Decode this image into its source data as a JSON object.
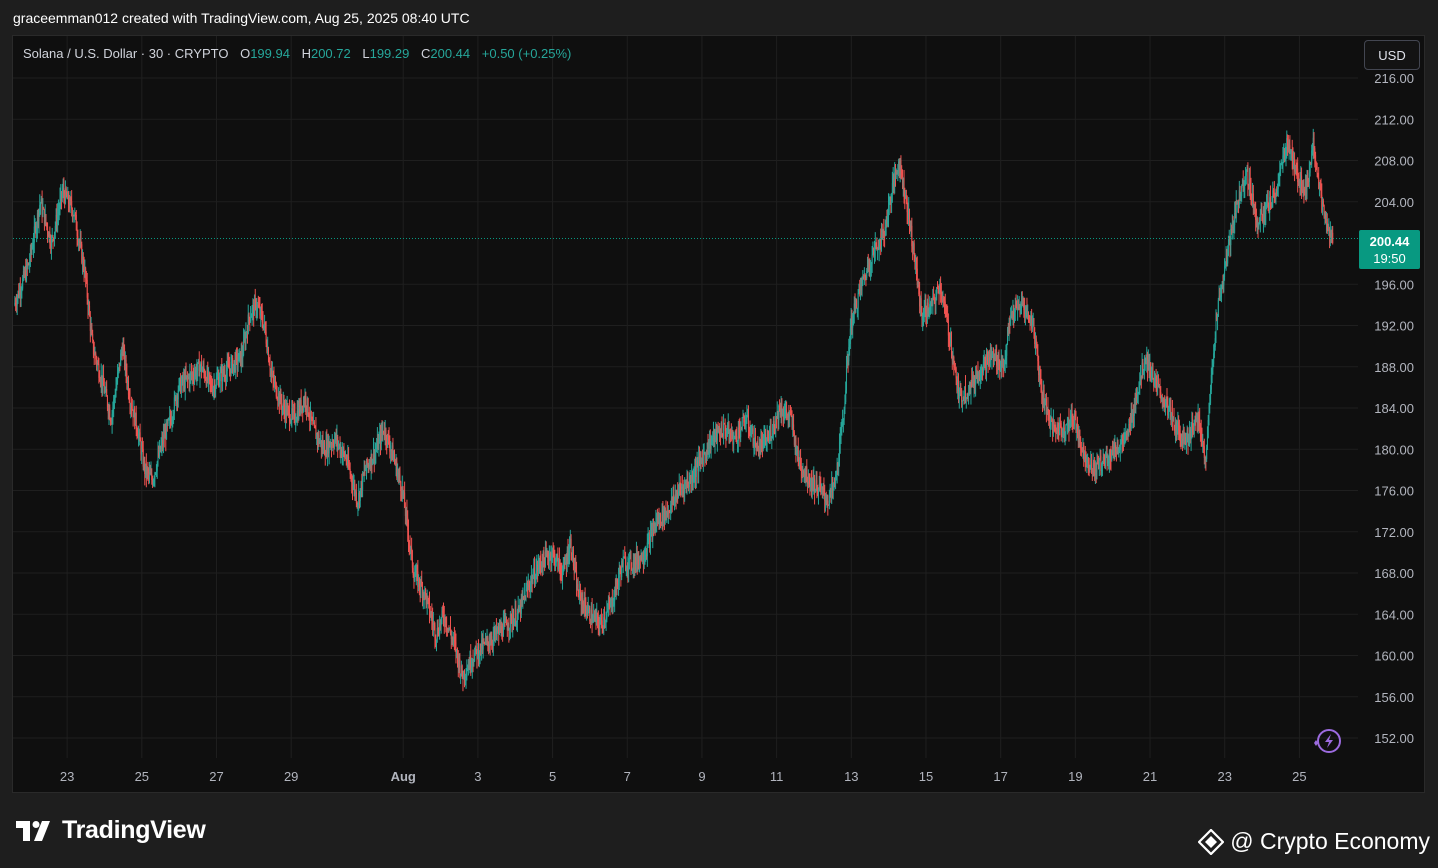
{
  "header": {
    "caption": "graceemman012 created with TradingView.com, Aug 25, 2025 08:40 UTC"
  },
  "legend": {
    "symbol": "Solana / U.S. Dollar · 30 · CRYPTO",
    "o_label": "O",
    "o_value": "199.94",
    "h_label": "H",
    "h_value": "200.72",
    "l_label": "L",
    "l_value": "199.29",
    "c_label": "C",
    "c_value": "200.44",
    "change": "+0.50 (+0.25%)"
  },
  "currency_button": "USD",
  "price_label": {
    "price": "200.44",
    "countdown": "19:50"
  },
  "colors": {
    "up": "#26a69a",
    "down": "#ef5350",
    "price_line": "#089981",
    "grid": "#1f1f1f",
    "background": "#0f0f0f",
    "accent_icon": "#9c6bdf"
  },
  "icons": {
    "logo": "tradingview-logo-icon",
    "credit": "crypto-economy-logo-icon",
    "flash": "lightning-icon"
  },
  "brand": {
    "name": "TradingView"
  },
  "credit": {
    "text": "@ Crypto Economy"
  },
  "chart_data": {
    "type": "candlestick",
    "title": "Solana / U.S. Dollar · 30 · CRYPTO",
    "timeframe": "30",
    "current_price": 200.44,
    "y_range": [
      150,
      217
    ],
    "y_ticks": [
      216,
      212,
      208,
      204,
      196,
      192,
      188,
      184,
      180,
      176,
      172,
      168,
      164,
      160,
      156,
      152
    ],
    "y_tick_labels": [
      "216.00",
      "212.00",
      "208.00",
      "204.00",
      "196.00",
      "192.00",
      "188.00",
      "184.00",
      "180.00",
      "176.00",
      "172.00",
      "168.00",
      "164.00",
      "160.00",
      "156.00",
      "152.00"
    ],
    "x_ticks": [
      {
        "label": "23",
        "day": 23
      },
      {
        "label": "25",
        "day": 25
      },
      {
        "label": "27",
        "day": 27
      },
      {
        "label": "29",
        "day": 29
      },
      {
        "label": "Aug",
        "day": 32,
        "bold": true
      },
      {
        "label": "3",
        "day": 34
      },
      {
        "label": "5",
        "day": 36
      },
      {
        "label": "7",
        "day": 38
      },
      {
        "label": "9",
        "day": 40
      },
      {
        "label": "11",
        "day": 42
      },
      {
        "label": "13",
        "day": 44
      },
      {
        "label": "15",
        "day": 46
      },
      {
        "label": "17",
        "day": 48
      },
      {
        "label": "19",
        "day": 50
      },
      {
        "label": "21",
        "day": 52
      },
      {
        "label": "23",
        "day": 54
      },
      {
        "label": "25",
        "day": 56
      }
    ],
    "x_day_range": [
      21.6,
      56.9
    ],
    "price_path": [
      [
        21.6,
        194
      ],
      [
        22.0,
        198
      ],
      [
        22.3,
        204
      ],
      [
        22.6,
        200
      ],
      [
        22.9,
        205
      ],
      [
        23.2,
        203
      ],
      [
        23.5,
        197
      ],
      [
        23.7,
        190
      ],
      [
        24.0,
        186
      ],
      [
        24.2,
        183
      ],
      [
        24.5,
        190
      ],
      [
        24.7,
        185
      ],
      [
        24.9,
        182
      ],
      [
        25.1,
        178
      ],
      [
        25.3,
        177
      ],
      [
        25.6,
        181
      ],
      [
        25.8,
        183
      ],
      [
        26.0,
        186
      ],
      [
        26.3,
        187
      ],
      [
        26.6,
        188
      ],
      [
        26.9,
        186
      ],
      [
        27.1,
        187
      ],
      [
        27.4,
        188
      ],
      [
        27.7,
        189
      ],
      [
        27.9,
        193
      ],
      [
        28.1,
        194
      ],
      [
        28.3,
        192
      ],
      [
        28.5,
        187
      ],
      [
        28.8,
        184
      ],
      [
        29.1,
        183
      ],
      [
        29.4,
        185
      ],
      [
        29.6,
        182
      ],
      [
        29.9,
        180
      ],
      [
        30.2,
        181
      ],
      [
        30.5,
        179
      ],
      [
        30.8,
        175
      ],
      [
        31.0,
        178
      ],
      [
        31.3,
        180
      ],
      [
        31.5,
        182
      ],
      [
        31.7,
        180
      ],
      [
        32.0,
        176
      ],
      [
        32.3,
        168
      ],
      [
        32.6,
        166
      ],
      [
        32.9,
        162
      ],
      [
        33.1,
        164
      ],
      [
        33.4,
        161
      ],
      [
        33.6,
        158
      ],
      [
        33.9,
        160
      ],
      [
        34.2,
        161
      ],
      [
        34.5,
        162
      ],
      [
        34.8,
        163
      ],
      [
        35.1,
        164
      ],
      [
        35.4,
        167
      ],
      [
        35.7,
        169
      ],
      [
        36.0,
        170
      ],
      [
        36.3,
        168
      ],
      [
        36.5,
        171
      ],
      [
        36.7,
        166
      ],
      [
        37.0,
        164
      ],
      [
        37.3,
        163
      ],
      [
        37.6,
        165
      ],
      [
        37.9,
        169
      ],
      [
        38.2,
        169
      ],
      [
        38.5,
        170
      ],
      [
        38.8,
        173
      ],
      [
        39.1,
        174
      ],
      [
        39.4,
        176
      ],
      [
        39.7,
        177
      ],
      [
        40.0,
        179
      ],
      [
        40.3,
        181
      ],
      [
        40.6,
        182
      ],
      [
        40.9,
        181
      ],
      [
        41.2,
        183
      ],
      [
        41.5,
        180
      ],
      [
        41.8,
        181
      ],
      [
        42.1,
        184
      ],
      [
        42.4,
        183
      ],
      [
        42.6,
        179
      ],
      [
        42.9,
        177
      ],
      [
        43.2,
        176
      ],
      [
        43.4,
        175
      ],
      [
        43.6,
        177
      ],
      [
        43.8,
        183
      ],
      [
        44.0,
        192
      ],
      [
        44.3,
        196
      ],
      [
        44.6,
        199
      ],
      [
        44.9,
        201
      ],
      [
        45.1,
        205
      ],
      [
        45.3,
        208
      ],
      [
        45.5,
        204
      ],
      [
        45.7,
        199
      ],
      [
        45.9,
        193
      ],
      [
        46.2,
        194
      ],
      [
        46.4,
        196
      ],
      [
        46.7,
        190
      ],
      [
        46.9,
        185
      ],
      [
        47.2,
        186
      ],
      [
        47.5,
        188
      ],
      [
        47.8,
        189
      ],
      [
        48.1,
        188
      ],
      [
        48.3,
        193
      ],
      [
        48.6,
        194
      ],
      [
        48.9,
        192
      ],
      [
        49.1,
        186
      ],
      [
        49.4,
        182
      ],
      [
        49.7,
        182
      ],
      [
        50.0,
        183
      ],
      [
        50.2,
        180
      ],
      [
        50.5,
        178
      ],
      [
        50.8,
        179
      ],
      [
        51.1,
        180
      ],
      [
        51.4,
        181
      ],
      [
        51.7,
        186
      ],
      [
        51.9,
        189
      ],
      [
        52.2,
        186
      ],
      [
        52.5,
        184
      ],
      [
        52.7,
        182
      ],
      [
        53.0,
        181
      ],
      [
        53.3,
        183
      ],
      [
        53.5,
        179
      ],
      [
        53.8,
        193
      ],
      [
        54.1,
        199
      ],
      [
        54.3,
        203
      ],
      [
        54.6,
        207
      ],
      [
        54.9,
        202
      ],
      [
        55.1,
        203
      ],
      [
        55.4,
        205
      ],
      [
        55.7,
        210
      ],
      [
        55.9,
        207
      ],
      [
        56.2,
        205
      ],
      [
        56.4,
        210
      ],
      [
        56.6,
        204
      ],
      [
        56.8,
        201
      ],
      [
        56.9,
        200.44
      ]
    ],
    "candles_per_day": 48,
    "grid": true,
    "legend_position": "top-left"
  }
}
